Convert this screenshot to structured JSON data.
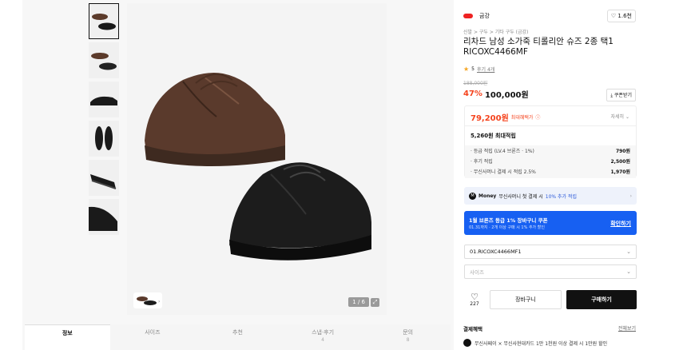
{
  "gallery": {
    "counter": "1 / 6",
    "thumbnail_count": 6
  },
  "tabs": [
    {
      "label": "정보",
      "count": ""
    },
    {
      "label": "사이즈",
      "count": ""
    },
    {
      "label": "추천",
      "count": ""
    },
    {
      "label": "스냅·후기",
      "count": "4"
    },
    {
      "label": "문의",
      "count": "8"
    }
  ],
  "brand": {
    "name": "금강",
    "likes": "1.6천"
  },
  "breadcrumb": "신발 > 구두 > 기타 구두 (금강)",
  "product": {
    "title": "리차드 남성 소가죽 티롤리안 슈즈 2종 택1 RICOXC4466MF",
    "rating": "5",
    "reviews": "후기 4개",
    "original_price": "188,000원",
    "discount": "47%",
    "price": "100,000원",
    "coupon_label": "쿠폰받기"
  },
  "benefit": {
    "max_price": "79,200원",
    "max_label": "최대혜택가",
    "detail_label": "자세히",
    "accumulate": "5,260원 최대적립",
    "items": [
      {
        "label": "· 등급 적립 (LV.4 브론즈 · 1%)",
        "value": "790원"
      },
      {
        "label": "· 후기 적립",
        "value": "2,500원"
      },
      {
        "label": "· 무신사머니 결제 시 적립 2.5%",
        "value": "1,970원"
      }
    ]
  },
  "money": {
    "brand": "Money",
    "text": "무신사머니 첫 결제 시",
    "highlight": "10% 추가 적립"
  },
  "banner": {
    "title": "1월 브론즈 등급 1% 장바구니 쿠폰",
    "subtitle": "01.31까지 · 2개 이상 구매 시 1% 추가 할인",
    "cta": "확인하기"
  },
  "options": {
    "selected": "01.RICOXC4466MF1",
    "size_placeholder": "사이즈"
  },
  "actions": {
    "likes": "227",
    "cart": "장바구니",
    "buy": "구매하기"
  },
  "payment": {
    "heading": "결제혜택",
    "more": "전체보기",
    "row": "무신사페이 × 무신사현대카드 1만 1천원 이상 결제 시 1만원 할인"
  },
  "colors": {
    "accent_red": "#f5431d",
    "blue": "#1760f2",
    "star": "#f5a623"
  }
}
